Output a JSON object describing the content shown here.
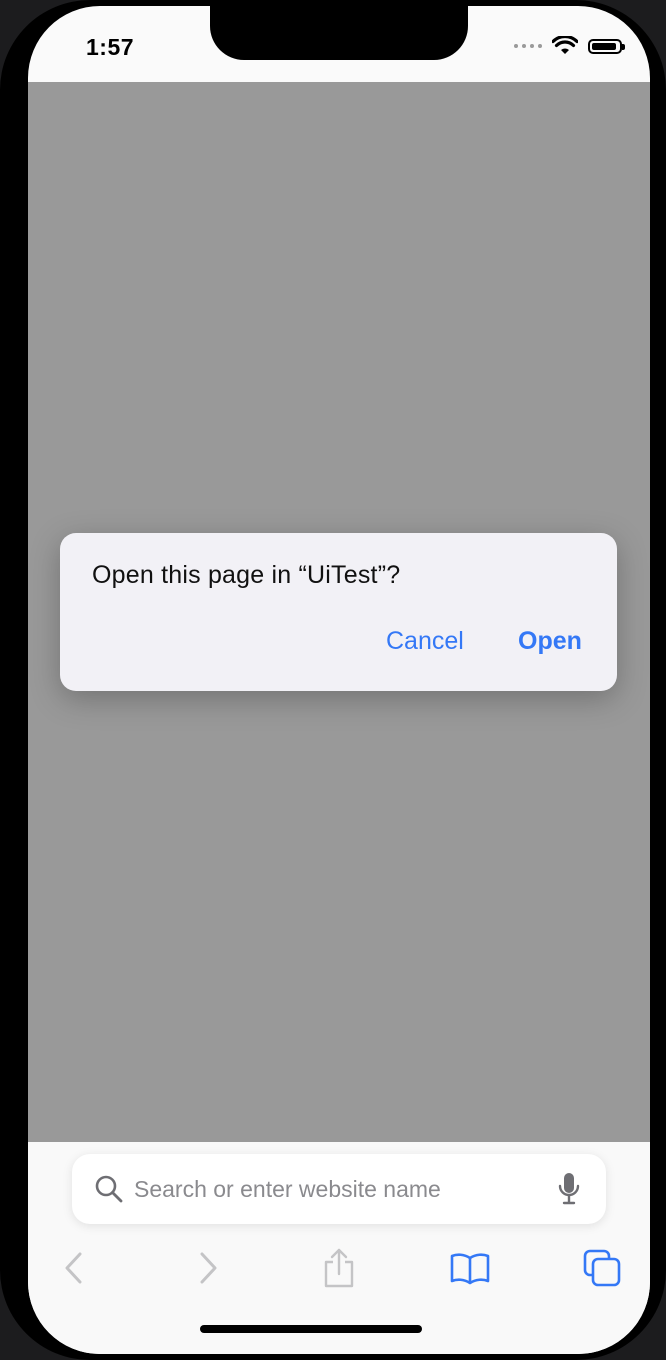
{
  "status_bar": {
    "time": "1:57"
  },
  "alert": {
    "message": "Open this page in “UiTest”?",
    "cancel_label": "Cancel",
    "open_label": "Open"
  },
  "search": {
    "placeholder": "Search or enter website name",
    "value": ""
  },
  "toolbar": {
    "icons": [
      "back-icon",
      "forward-icon",
      "share-icon",
      "bookmarks-icon",
      "tabs-icon"
    ]
  },
  "colors": {
    "accent": "#3478f6",
    "overlay": "#999999",
    "alert_bg": "#f2f1f6",
    "toolbar_bg": "#f9f9f9"
  }
}
